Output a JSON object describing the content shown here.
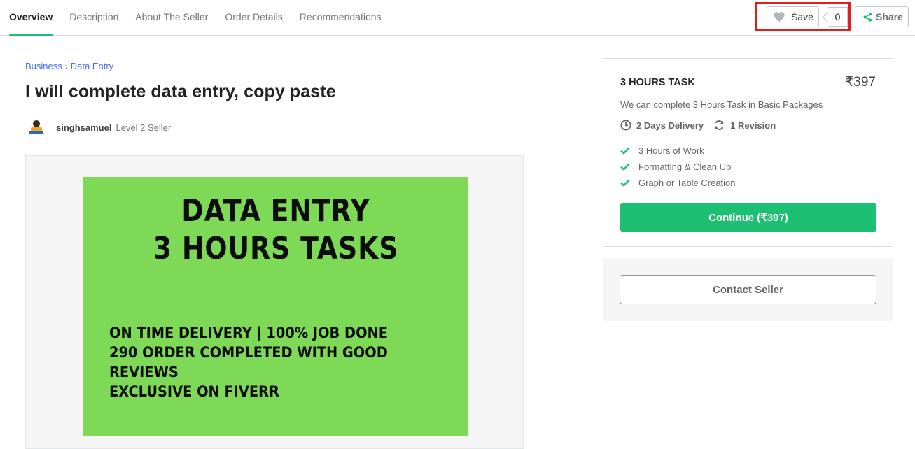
{
  "nav": {
    "tabs": [
      {
        "label": "Overview",
        "active": true
      },
      {
        "label": "Description"
      },
      {
        "label": "About The Seller"
      },
      {
        "label": "Order Details"
      },
      {
        "label": "Recommendations"
      }
    ],
    "save_label": "Save",
    "save_count": "0",
    "share_label": "Share"
  },
  "breadcrumb": {
    "items": [
      "Business",
      "Data Entry"
    ]
  },
  "gig": {
    "title": "I will complete data entry, copy paste",
    "seller_name": "singhsamuel",
    "seller_level": "Level 2 Seller",
    "image": {
      "heading_line1": "DATA ENTRY",
      "heading_line2": "3 HOURS TASKS",
      "line1": "ON TIME DELIVERY | 100% JOB DONE",
      "line2": "290 ORDER COMPLETED WITH GOOD",
      "line3": "REVIEWS",
      "line4": "EXCLUSIVE ON FIVERR",
      "background_color": "#7ed957"
    }
  },
  "package": {
    "name": "3 HOURS TASK",
    "price": "₹397",
    "description": "We can complete 3 Hours Task in Basic Packages",
    "delivery": "2 Days Delivery",
    "revisions": "1 Revision",
    "features": [
      "3 Hours of Work",
      "Formatting & Clean Up",
      "Graph or Table Creation"
    ],
    "continue_label": "Continue (₹397)"
  },
  "contact": {
    "label": "Contact Seller"
  },
  "colors": {
    "accent": "#1dbf73",
    "link": "#446ee7",
    "highlight": "#e0201e"
  }
}
